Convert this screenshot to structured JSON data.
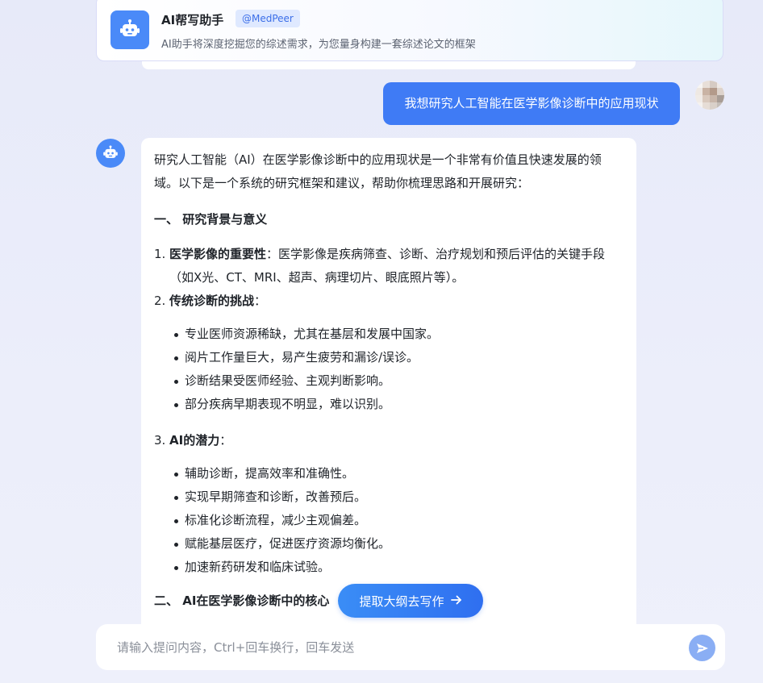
{
  "assistant": {
    "title": "AI帮写助手",
    "badge": "@MedPeer",
    "description": "AI助手将深度挖掘您的综述需求，为您量身构建一套综述论文的框架",
    "icon": "robot-icon"
  },
  "user_message": "我想研究人工智能在医学影像诊断中的应用现状",
  "answer": {
    "intro": "研究人工智能（AI）在医学影像诊断中的应用现状是一个非常有价值且快速发展的领域。以下是一个系统的研究框架和建议，帮助你梳理思路和开展研究：",
    "section1_heading": "一、 研究背景与意义",
    "item1_number": "1.",
    "item1_title": "医学影像的重要性",
    "item1_text": "：医学影像是疾病筛查、诊断、治疗规划和预后评估的关键手段（如X光、CT、MRI、超声、病理切片、眼底照片等）。",
    "item2_number": "2.",
    "item2_title": "传统诊断的挑战",
    "item2_text": "：",
    "item2_bullets": [
      "专业医师资源稀缺，尤其在基层和发展中国家。",
      "阅片工作量巨大，易产生疲劳和漏诊/误诊。",
      "诊断结果受医师经验、主观判断影响。",
      "部分疾病早期表现不明显，难以识别。"
    ],
    "item3_number": "3.",
    "item3_title": "AI的潜力",
    "item3_text": "：",
    "item3_bullets": [
      "辅助诊断，提高效率和准确性。",
      "实现早期筛查和诊断，改善预后。",
      "标准化诊断流程，减少主观偏差。",
      "赋能基层医疗，促进医疗资源均衡化。",
      "加速新药研发和临床试验。"
    ],
    "section2_heading": "二、 AI在医学影像诊断中的核心"
  },
  "outline_button": {
    "label": "提取大纲去写作",
    "icon": "arrow-right-icon"
  },
  "input": {
    "placeholder": "请输入提问内容，Ctrl+回车换行，回车发送",
    "value": ""
  },
  "colors": {
    "accent": "#3f7bf5",
    "send_button": "#8aaef4",
    "background": "#e9ecf9"
  }
}
